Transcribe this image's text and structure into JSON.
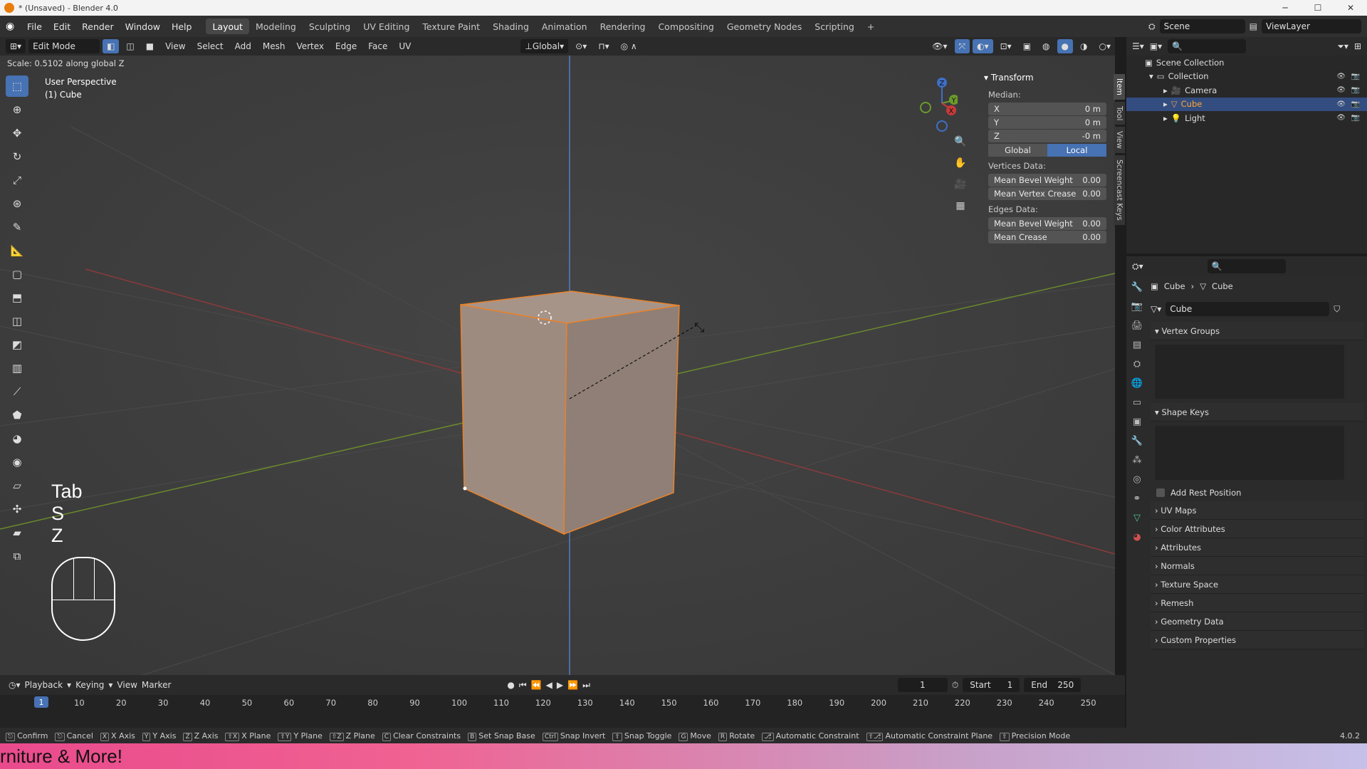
{
  "window": {
    "title": "* (Unsaved) - Blender 4.0"
  },
  "menus": [
    "File",
    "Edit",
    "Render",
    "Window",
    "Help"
  ],
  "workspaces": [
    "Layout",
    "Modeling",
    "Sculpting",
    "UV Editing",
    "Texture Paint",
    "Shading",
    "Animation",
    "Rendering",
    "Compositing",
    "Geometry Nodes",
    "Scripting",
    "+"
  ],
  "active_workspace": "Layout",
  "top_right": {
    "scene": "Scene",
    "view_layer": "ViewLayer"
  },
  "vp_header": {
    "mode": "Edit Mode",
    "menus": [
      "View",
      "Select",
      "Add",
      "Mesh",
      "Vertex",
      "Edge",
      "Face",
      "UV"
    ],
    "orientation": "Global"
  },
  "op_status": "Scale: 0.5102 along global Z",
  "viewport": {
    "perspective": "User Perspective",
    "object": "(1) Cube",
    "keys": [
      "Tab",
      "S",
      "Z"
    ]
  },
  "npanel": {
    "title": "Transform",
    "median_label": "Median:",
    "x": {
      "label": "X",
      "value": "0 m"
    },
    "y": {
      "label": "Y",
      "value": "0 m"
    },
    "z": {
      "label": "Z",
      "value": "-0 m"
    },
    "global": "Global",
    "local": "Local",
    "vertices_label": "Vertices Data:",
    "mean_bevel_weight": {
      "label": "Mean Bevel Weight",
      "value": "0.00"
    },
    "mean_vertex_crease": {
      "label": "Mean Vertex Crease",
      "value": "0.00"
    },
    "edges_label": "Edges Data:",
    "edge_bevel_weight": {
      "label": "Mean Bevel Weight",
      "value": "0.00"
    },
    "mean_crease": {
      "label": "Mean Crease",
      "value": "0.00"
    },
    "tabs": [
      "Item",
      "Tool",
      "View",
      "Screencast Keys"
    ]
  },
  "outliner": {
    "scene_collection": "Scene Collection",
    "collection": "Collection",
    "items": [
      "Camera",
      "Cube",
      "Light"
    ]
  },
  "properties": {
    "breadcrumb_object": "Cube",
    "breadcrumb_mesh": "Cube",
    "mesh_name": "Cube",
    "vertex_groups": "Vertex Groups",
    "shape_keys": "Shape Keys",
    "add_rest_position": "Add Rest Position",
    "sections": [
      "UV Maps",
      "Color Attributes",
      "Attributes",
      "Normals",
      "Texture Space",
      "Remesh",
      "Geometry Data",
      "Custom Properties"
    ]
  },
  "timeline": {
    "menus": [
      "Playback",
      "Keying",
      "View",
      "Marker"
    ],
    "current_frame": "1",
    "start_label": "Start",
    "start": "1",
    "end_label": "End",
    "end": "250",
    "ticks": [
      "1",
      "10",
      "20",
      "30",
      "40",
      "50",
      "60",
      "70",
      "80",
      "90",
      "100",
      "110",
      "120",
      "130",
      "140",
      "150",
      "160",
      "170",
      "180",
      "190",
      "200",
      "210",
      "220",
      "230",
      "240",
      "250"
    ]
  },
  "statusbar": {
    "items": [
      "Confirm",
      "Cancel",
      "X Axis",
      "Y Axis",
      "Z Axis",
      "X Plane",
      "Y Plane",
      "Z Plane",
      "Clear Constraints",
      "Set Snap Base",
      "Snap Invert",
      "Snap Toggle",
      "Move",
      "Rotate",
      "Automatic Constraint",
      "Automatic Constraint Plane",
      "Precision Mode"
    ],
    "version": "4.0.2"
  },
  "banner": {
    "text": "rniture & More!"
  }
}
